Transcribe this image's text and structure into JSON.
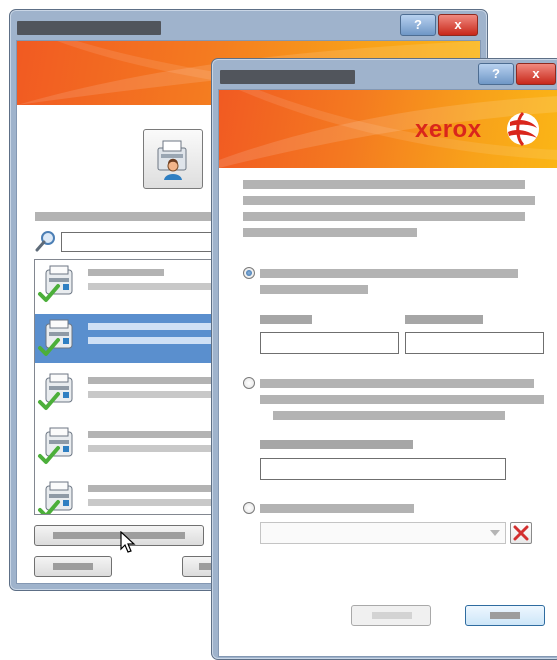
{
  "back_window": {
    "title": "",
    "help_label": "?",
    "close_label": "x",
    "filter_label": "",
    "search_placeholder": "",
    "printers": [
      {
        "name": "",
        "status": ""
      },
      {
        "name": "",
        "status": ""
      },
      {
        "name": "",
        "status": ""
      },
      {
        "name": "",
        "status": ""
      },
      {
        "name": "",
        "status": ""
      }
    ],
    "selected_index": 1,
    "button_labels": [
      "",
      "",
      ""
    ]
  },
  "front_window": {
    "title": "",
    "help_label": "?",
    "close_label": "x",
    "brand": "xerox",
    "intro_text": [
      "",
      "",
      "",
      ""
    ],
    "option_labels": [
      "",
      "",
      ""
    ],
    "selected_option": 0,
    "fields": [
      "",
      "",
      ""
    ],
    "dropdown_value": "",
    "ok_label": "",
    "cancel_label": ""
  },
  "colors": {
    "accent_orange": "#f47a20",
    "selection_blue": "#5a8fce",
    "check_green": "#4caf3a",
    "delete_red": "#d32f2f"
  }
}
